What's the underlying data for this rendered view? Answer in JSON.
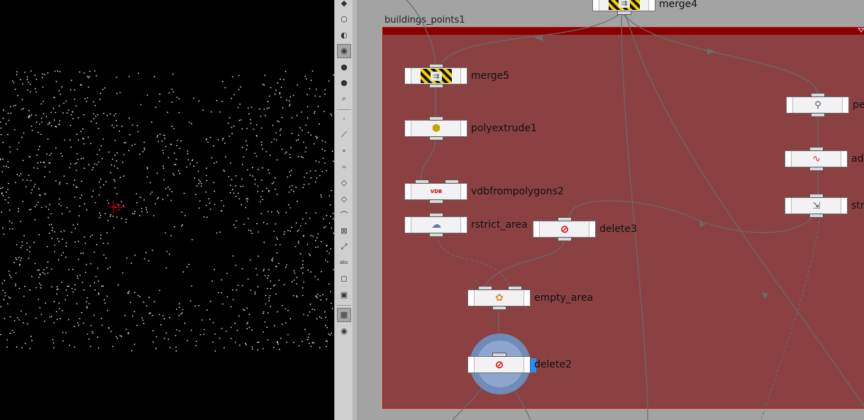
{
  "viewport": {
    "crosshair_color": "#cc0000",
    "point_color": "#e0e0d0"
  },
  "toolbar": {
    "tools": [
      {
        "name": "select-tool-icon",
        "glyph": "◆"
      },
      {
        "name": "circle-icon",
        "glyph": "○"
      },
      {
        "name": "light-icon",
        "glyph": "◐"
      },
      {
        "name": "spot-light-icon",
        "glyph": "◉",
        "active": true
      },
      {
        "name": "ambient-light-icon",
        "glyph": "●"
      },
      {
        "name": "sphere-icon",
        "glyph": "●"
      },
      {
        "name": "camera-icon",
        "glyph": "⌕"
      },
      {
        "name": "point-icon",
        "glyph": "·"
      },
      {
        "name": "edge-icon",
        "glyph": "⟋"
      },
      {
        "name": "vertex-icon",
        "glyph": "∘"
      },
      {
        "name": "number-icon",
        "glyph": "₁₂"
      },
      {
        "name": "primitive-icon",
        "glyph": "◇"
      },
      {
        "name": "prim-number-icon",
        "glyph": "◇"
      },
      {
        "name": "curve-icon",
        "glyph": "⌒"
      },
      {
        "name": "transform-icon",
        "glyph": "⊠"
      },
      {
        "name": "handle-icon",
        "glyph": "⤢"
      },
      {
        "name": "text-icon",
        "glyph": "abc"
      },
      {
        "name": "comment-icon",
        "glyph": "◻"
      },
      {
        "name": "image-icon",
        "glyph": "▣"
      },
      {
        "name": "grid-view-icon",
        "glyph": "▦",
        "active": true
      },
      {
        "name": "eye-icon",
        "glyph": "◉"
      }
    ]
  },
  "network": {
    "netbox_title": "buildings_points1",
    "nodes": {
      "merge4": "merge4",
      "merge5": "merge5",
      "polyextrude1": "polyextrude1",
      "vdbfrompolygons2": "vdbfrompolygons2",
      "rstrict_area": "rstrict_area",
      "delete3": "delete3",
      "empty_area": "empty_area",
      "delete2": "delete2",
      "pe": "pe",
      "ad": "ad",
      "str": "str"
    },
    "icons": {
      "merge": "⇉",
      "polyextrude": "⬢",
      "vdb": "VDB",
      "rstrict": "☁",
      "delete": "⊘",
      "empty": "✿",
      "pe": "⚲",
      "ad": "∿",
      "str": "⇲"
    },
    "colors": {
      "netbox_bg": "#8b4142",
      "netbox_bar": "#8a0000",
      "selected_ring": "#6f8bb8",
      "display_flag": "#1e90ff"
    }
  }
}
